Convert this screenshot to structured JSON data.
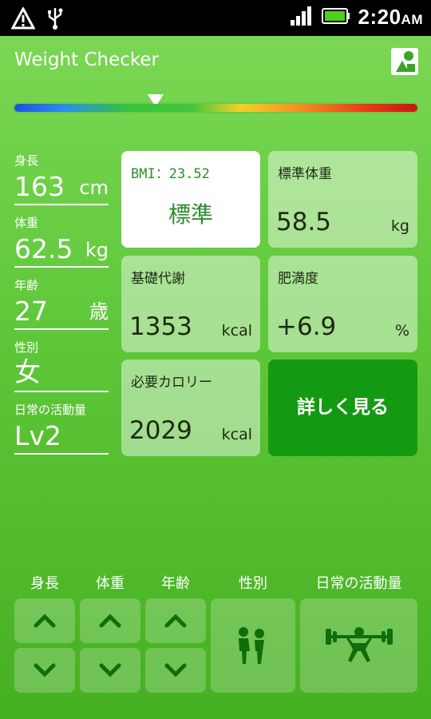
{
  "statusbar": {
    "time": "2:20",
    "ampm": "AM",
    "icons": [
      "warning-icon",
      "usb-icon",
      "signal-icon",
      "battery-icon"
    ]
  },
  "header": {
    "title": "Weight Checker",
    "app_icon": "share-icon"
  },
  "scale": {
    "marker_fraction": 0.35
  },
  "fields": {
    "height": {
      "label": "身長",
      "value": "163",
      "unit": "cm"
    },
    "weight": {
      "label": "体重",
      "value": "62.5",
      "unit": "kg"
    },
    "age": {
      "label": "年齢",
      "value": "27",
      "unit": "歳"
    },
    "gender": {
      "label": "性別",
      "value": "女"
    },
    "activity": {
      "label": "日常の活動量",
      "value": "Lv2"
    }
  },
  "cards": {
    "bmi": {
      "label": "BMI：23.52",
      "status": "標準"
    },
    "std_weight": {
      "label": "標準体重",
      "value": "58.5",
      "unit": "kg"
    },
    "bmr": {
      "label": "基礎代謝",
      "value": "1353",
      "unit": "kcal"
    },
    "obesity": {
      "label": "肥満度",
      "value": "+6.9",
      "unit": "%"
    },
    "calorie": {
      "label": "必要カロリー",
      "value": "2029",
      "unit": "kcal"
    },
    "detail_button": "詳しく見る"
  },
  "controls": {
    "labels": [
      "身長",
      "体重",
      "年齢",
      "性別",
      "日常の活動量"
    ]
  },
  "colors": {
    "background_top": "#7ed957",
    "background_bottom": "#45b021",
    "accent": "#149a12",
    "bmi_text": "#2e8b2e"
  }
}
